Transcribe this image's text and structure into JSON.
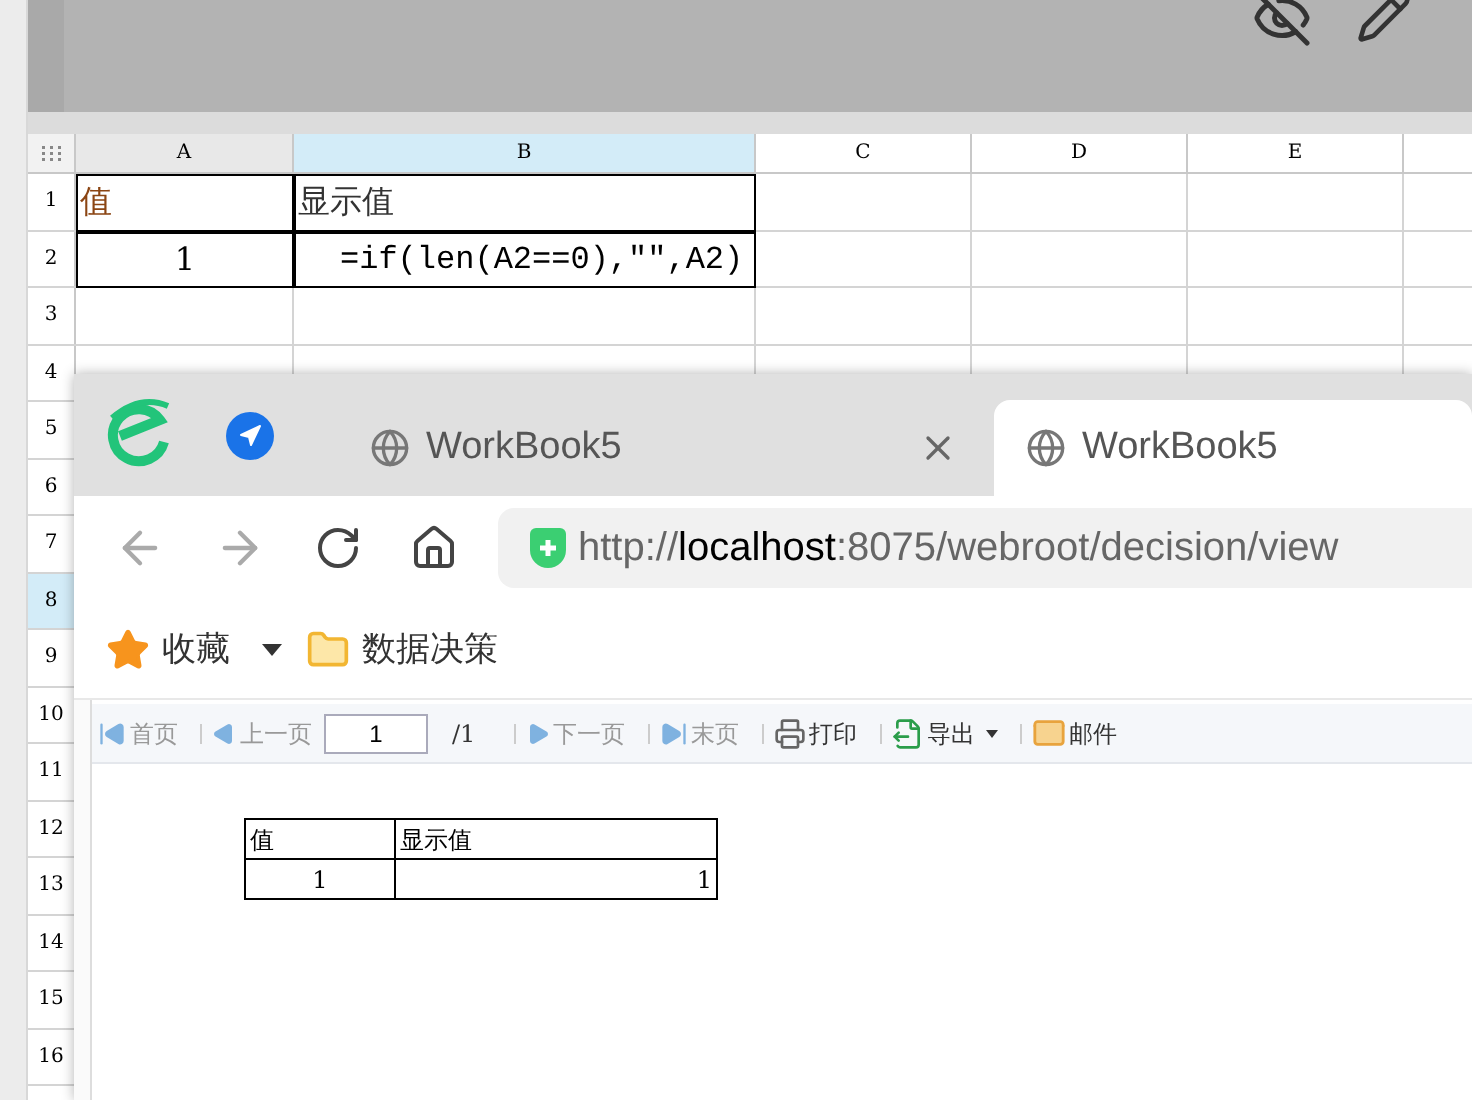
{
  "spreadsheet": {
    "columns": [
      {
        "label": "A",
        "selected": false
      },
      {
        "label": "B",
        "selected": true
      },
      {
        "label": "C",
        "selected": false
      },
      {
        "label": "D",
        "selected": false
      },
      {
        "label": "E",
        "selected": false
      }
    ],
    "rows": [
      {
        "label": "1",
        "selected": false,
        "cells": [
          {
            "text": "值",
            "kind": "label"
          },
          {
            "text": "显示值",
            "kind": "text"
          }
        ]
      },
      {
        "label": "2",
        "selected": false,
        "cells": [
          {
            "text": "1",
            "kind": "number"
          },
          {
            "text": "=if(len(A2==0),\"\",A2)",
            "kind": "formula"
          }
        ]
      },
      {
        "label": "3",
        "selected": false,
        "cells": []
      },
      {
        "label": "4",
        "selected": false,
        "cells": []
      },
      {
        "label": "5",
        "selected": false,
        "cells": []
      },
      {
        "label": "6",
        "selected": false,
        "cells": []
      },
      {
        "label": "7",
        "selected": false,
        "cells": []
      },
      {
        "label": "8",
        "selected": true,
        "cells": []
      },
      {
        "label": "9",
        "selected": false,
        "cells": []
      },
      {
        "label": "10",
        "selected": false,
        "cells": []
      },
      {
        "label": "11",
        "selected": false,
        "cells": []
      },
      {
        "label": "12",
        "selected": false,
        "cells": []
      },
      {
        "label": "13",
        "selected": false,
        "cells": []
      },
      {
        "label": "14",
        "selected": false,
        "cells": []
      },
      {
        "label": "15",
        "selected": false,
        "cells": []
      },
      {
        "label": "16",
        "selected": false,
        "cells": []
      }
    ]
  },
  "browser": {
    "tabs": [
      {
        "title": "WorkBook5",
        "selected": false
      },
      {
        "title": "WorkBook5",
        "selected": true
      }
    ],
    "address": {
      "scheme": "http://",
      "host": "localhost",
      "rest": ":8075/webroot/decision/view"
    },
    "bookmarks": [
      {
        "kind": "favorites",
        "label": "收藏"
      },
      {
        "kind": "folder",
        "label": "数据决策"
      }
    ]
  },
  "report_toolbar": [
    {
      "kind": "first",
      "label": "首页",
      "disabled": true
    },
    {
      "kind": "prev",
      "label": "上一页",
      "disabled": true
    },
    {
      "kind": "page",
      "value": "1",
      "total": "/1"
    },
    {
      "kind": "next",
      "label": "下一页",
      "disabled": true
    },
    {
      "kind": "last",
      "label": "末页",
      "disabled": true
    },
    {
      "kind": "print",
      "label": "打印",
      "disabled": false
    },
    {
      "kind": "export",
      "label": "导出",
      "disabled": false
    },
    {
      "kind": "mail",
      "label": "邮件",
      "disabled": false
    }
  ],
  "report_table": {
    "columns": [
      "值",
      "显示值"
    ],
    "rows": [
      [
        "1",
        "1"
      ]
    ]
  }
}
